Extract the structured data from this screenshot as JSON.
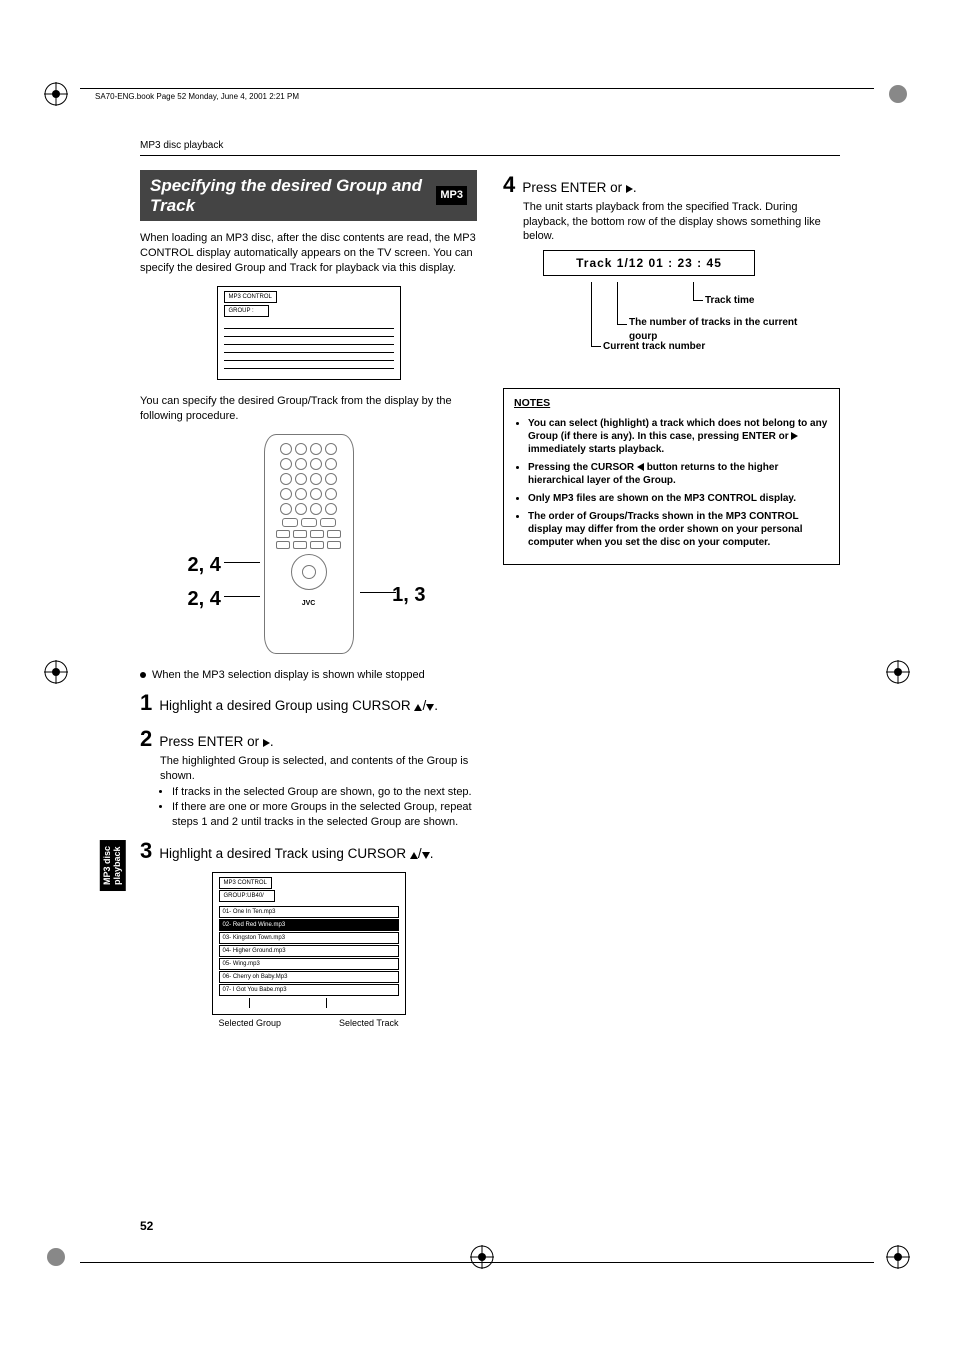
{
  "header_line": "SA70-ENG.book  Page 52  Monday, June 4, 2001  2:21 PM",
  "running_head": "MP3 disc playback",
  "title": "Specifying the desired Group and Track",
  "badge": "MP3",
  "intro1": "When loading an MP3 disc, after the disc contents are read, the MP3 CONTROL display automatically appears on the TV screen. You can specify the desired Group and Track for playback via this display.",
  "mp3ctrl_label": "MP3 CONTROL",
  "mp3ctrl_group": "GROUP :",
  "intro2": "You can specify the desired Group/Track from the display by the following procedure.",
  "callout_left_a": "2, 4",
  "callout_left_b": "2, 4",
  "callout_right": "1, 3",
  "remote_brand": "JVC",
  "precond": "When the MP3 selection display is shown while stopped",
  "steps": {
    "s1": {
      "num": "1",
      "txt": "Highlight a desired Group using CURSOR "
    },
    "s2": {
      "num": "2",
      "txt": "Press ENTER or ",
      "body": "The highlighted Group is selected, and contents of the Group is shown.",
      "b1": "If tracks in the selected Group are shown, go to the next step.",
      "b2": "If there are one or more Groups in the selected Group, repeat steps 1 and 2 until tracks in the selected Group are shown."
    },
    "s3": {
      "num": "3",
      "txt": "Highlight a desired Track using CURSOR "
    },
    "s4": {
      "num": "4",
      "txt": "Press ENTER or ",
      "body": "The unit starts playback from the specified Track. During playback, the bottom row of the display shows something like below."
    }
  },
  "mp3box2": {
    "label": "MP3 CONTROL",
    "group": "GROUP:UB40/",
    "tracks": [
      "01- One In Ten.mp3",
      "02- Red Red Wine.mp3",
      "03- Kingston Town.mp3",
      "04- Higher Ground.mp3",
      "05- Wing.mp3",
      "06- Cherry oh Baby.Mp3",
      "07- I Got You Babe.mp3"
    ]
  },
  "caplabels": {
    "a": "Selected Group",
    "b": "Selected Track"
  },
  "trackdisplay": "Track 1/12    01 : 23 : 45",
  "disp_labels": {
    "a": "Track time",
    "b": "The number of tracks in the current gourp",
    "c": "Current track number"
  },
  "notes": {
    "h": "NOTES",
    "n1a": "You can select (highlight) a track which does not belong to any Group (if there is any). In this case, pressing ENTER or ",
    "n1b": " immediately starts playback.",
    "n2a": "Pressing the CURSOR ",
    "n2b": " button returns to the higher hierarchical layer of the Group.",
    "n3": "Only MP3 files are shown on the MP3 CONTROL display.",
    "n4": "The order of Groups/Tracks shown in the MP3 CONTROL display may differ from the order shown on your personal computer when you set the disc on your computer."
  },
  "sidetab": {
    "a": "MP3 disc",
    "b": "playback"
  },
  "pagenum": "52",
  "updn_sep": "/",
  "period": "."
}
